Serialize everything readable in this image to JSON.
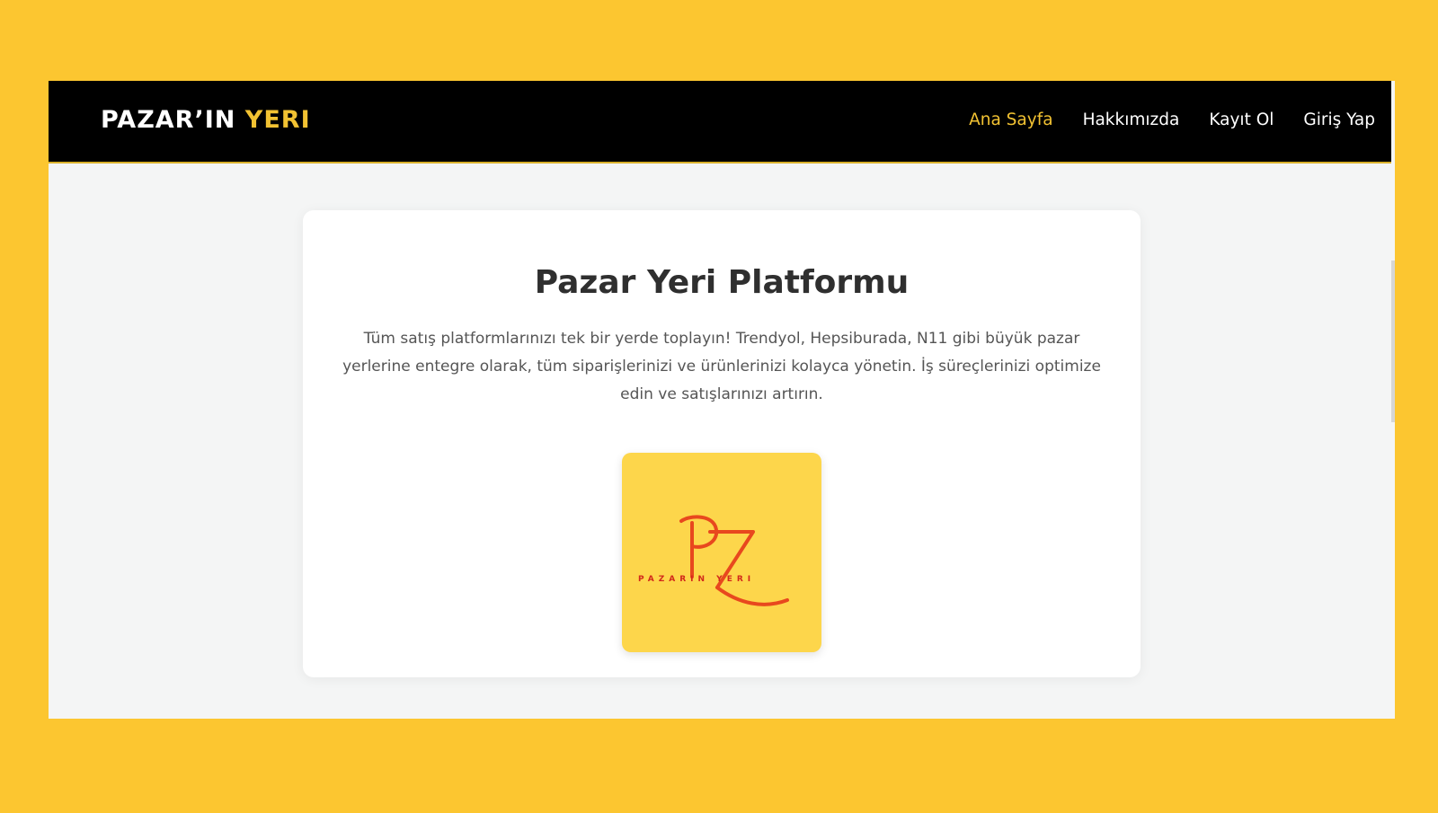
{
  "navbar": {
    "brand_main": "PAZAR’IN",
    "brand_accent": "YERI",
    "links": [
      {
        "label": "Ana Sayfa",
        "active": true
      },
      {
        "label": "Hakkımızda",
        "active": false
      },
      {
        "label": "Kayıt Ol",
        "active": false
      },
      {
        "label": "Giriş Yap",
        "active": false
      }
    ]
  },
  "hero": {
    "title": "Pazar Yeri Platformu",
    "description": "Tüm satış platformlarınızı tek bir yerde toplayın! Trendyol, Hepsiburada, N11 gibi büyük pazar yerlerine entegre olarak, tüm siparişlerinizi ve ürünlerinizi kolayca yönetin. İş süreçlerinizi optimize edin ve satışlarınızı artırın.",
    "logo": {
      "monogram": "PZ",
      "wordmark": "PAZARIN YERI"
    }
  },
  "colors": {
    "page_background": "#fcc630",
    "navbar": "#000000",
    "accent": "#f2c232",
    "logo_background": "#fdd64b",
    "logo_mark": "#e8481e"
  }
}
